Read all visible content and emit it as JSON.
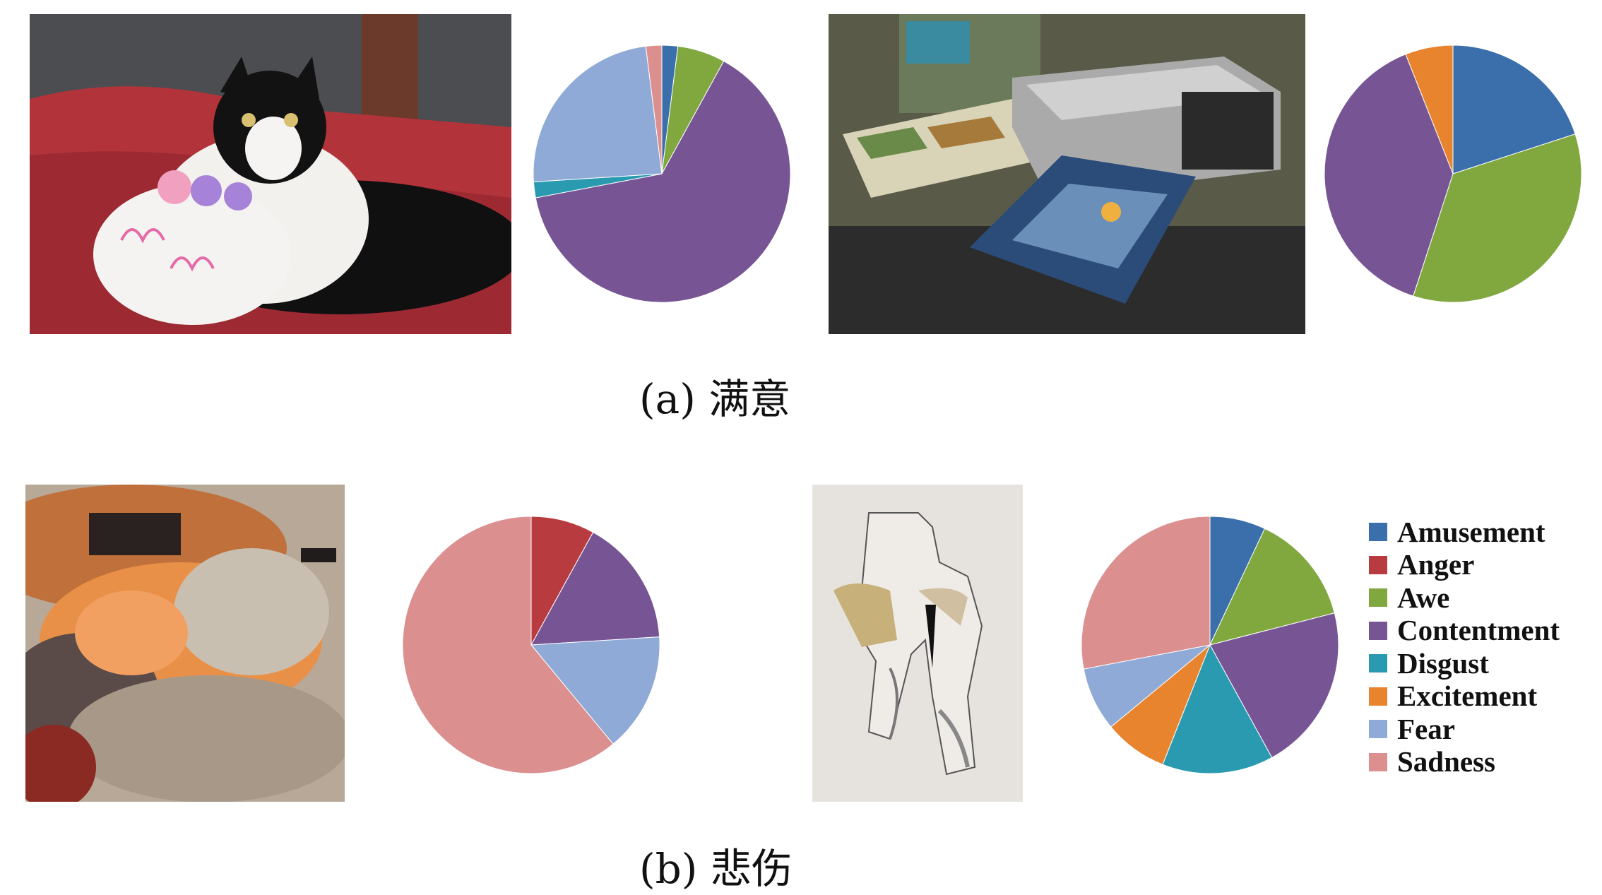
{
  "captions": {
    "a": "(a) 满意",
    "b": "(b) 悲伤"
  },
  "legend": [
    {
      "label": "Amusement",
      "color": "#3a6fab"
    },
    {
      "label": "Anger",
      "color": "#b83c3f"
    },
    {
      "label": "Awe",
      "color": "#80a83f"
    },
    {
      "label": "Contentment",
      "color": "#775595"
    },
    {
      "label": "Disgust",
      "color": "#2a9ab0"
    },
    {
      "label": "Excitement",
      "color": "#e8842e"
    },
    {
      "label": "Fear",
      "color": "#8faad6"
    },
    {
      "label": "Sadness",
      "color": "#dc8f8f"
    }
  ],
  "chart_data": [
    {
      "type": "pie",
      "group": "a",
      "categories": [
        "Amusement",
        "Anger",
        "Awe",
        "Contentment",
        "Disgust",
        "Excitement",
        "Fear",
        "Sadness"
      ],
      "values": [
        0.02,
        0,
        0.06,
        0.64,
        0.02,
        0,
        0.24,
        0.02
      ]
    },
    {
      "type": "pie",
      "group": "a",
      "categories": [
        "Amusement",
        "Anger",
        "Awe",
        "Contentment",
        "Disgust",
        "Excitement",
        "Fear",
        "Sadness"
      ],
      "values": [
        0.2,
        0,
        0.35,
        0.39,
        0,
        0.06,
        0,
        0
      ]
    },
    {
      "type": "pie",
      "group": "b",
      "categories": [
        "Amusement",
        "Anger",
        "Awe",
        "Contentment",
        "Disgust",
        "Excitement",
        "Fear",
        "Sadness"
      ],
      "values": [
        0,
        0.08,
        0,
        0.16,
        0,
        0,
        0.15,
        0.61
      ]
    },
    {
      "type": "pie",
      "group": "b",
      "categories": [
        "Amusement",
        "Anger",
        "Awe",
        "Contentment",
        "Disgust",
        "Excitement",
        "Fear",
        "Sadness"
      ],
      "values": [
        0.07,
        0,
        0.14,
        0.21,
        0.14,
        0.08,
        0.08,
        0.28
      ]
    }
  ]
}
